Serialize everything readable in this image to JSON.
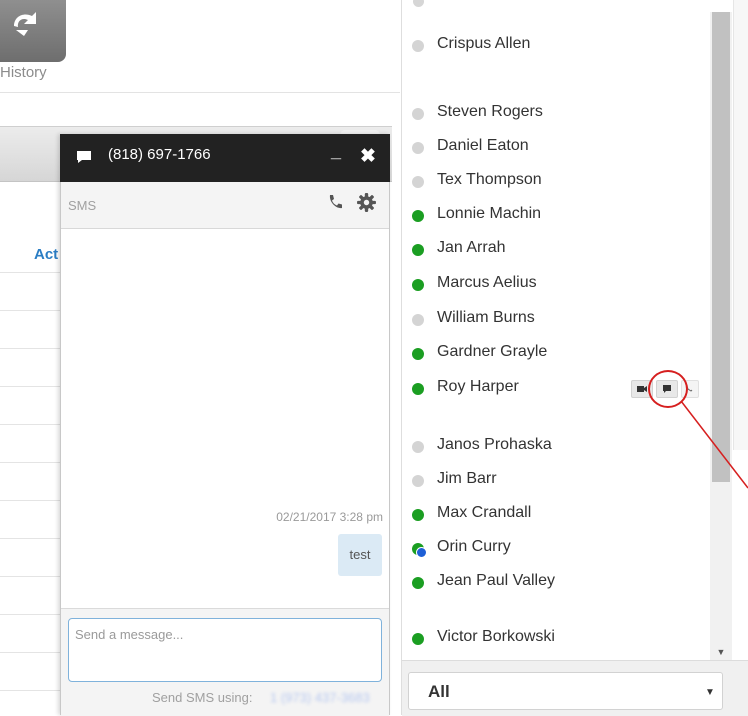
{
  "background_app": {
    "history_label": "History",
    "column_header": "Act"
  },
  "chat": {
    "phone_number": "(818) 697-1766",
    "min_label": "_",
    "close_label": "✖",
    "channel_label": "SMS",
    "message": {
      "timestamp": "02/21/2017 3:28 pm",
      "text": "test"
    },
    "input_placeholder": "Send a message...",
    "send_using_label": "Send SMS using:",
    "send_using_number": "1 (973) 437-3683"
  },
  "contacts": [
    {
      "name": "Crispus Allen",
      "status": "offline"
    },
    {
      "name": "Steven Rogers",
      "status": "offline"
    },
    {
      "name": "Daniel Eaton",
      "status": "offline"
    },
    {
      "name": "Tex Thompson",
      "status": "offline"
    },
    {
      "name": "Lonnie Machin",
      "status": "online"
    },
    {
      "name": "Jan Arrah",
      "status": "online"
    },
    {
      "name": "Marcus Aelius",
      "status": "online"
    },
    {
      "name": "William Burns",
      "status": "offline"
    },
    {
      "name": "Gardner Grayle",
      "status": "online"
    },
    {
      "name": "Roy Harper",
      "status": "online"
    },
    {
      "name": "Janos Prohaska",
      "status": "offline"
    },
    {
      "name": "Jim Barr",
      "status": "offline"
    },
    {
      "name": "Max Crandall",
      "status": "online"
    },
    {
      "name": "Orin Curry",
      "status": "mixed"
    },
    {
      "name": "Jean Paul Valley",
      "status": "online"
    },
    {
      "name": "Victor Borkowski",
      "status": "online"
    }
  ],
  "filter": {
    "selected": "All"
  },
  "colors": {
    "online": "#1b9e22",
    "offline": "#d4d4d4",
    "titlebar": "#222222",
    "accent": "#2a7dc4",
    "annotation": "#d61f1f"
  },
  "icons": [
    "history-icon",
    "chat-bubble-icon",
    "phone-icon",
    "gear-icon",
    "video-icon",
    "message-icon"
  ]
}
